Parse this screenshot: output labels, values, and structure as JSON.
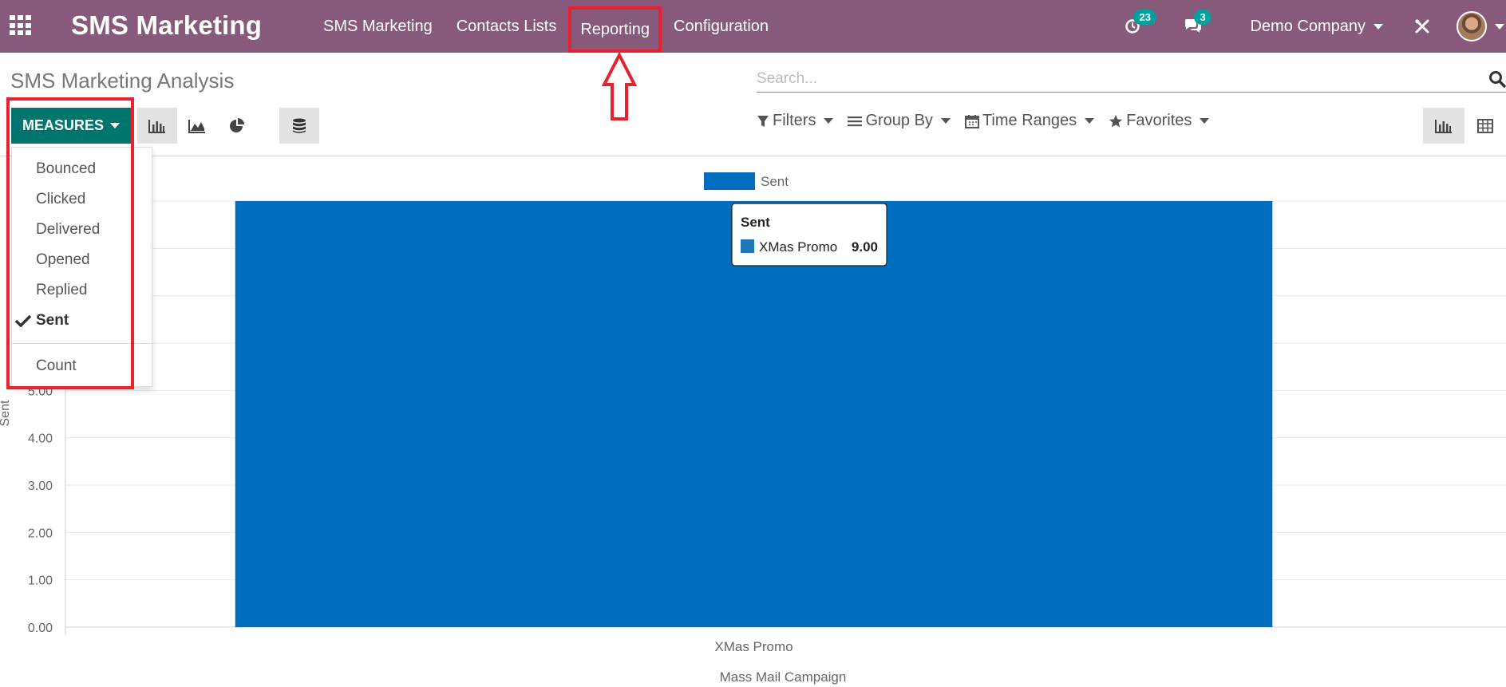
{
  "app": {
    "brand": "SMS Marketing",
    "menu": [
      "SMS Marketing",
      "Contacts Lists",
      "Reporting",
      "Configuration"
    ],
    "activity_count": "23",
    "message_count": "3",
    "company": "Demo Company"
  },
  "page": {
    "title": "SMS Marketing Analysis",
    "search_placeholder": "Search...",
    "measures_label": "MEASURES",
    "filters_label": "Filters",
    "groupby_label": "Group By",
    "timeranges_label": "Time Ranges",
    "favorites_label": "Favorites"
  },
  "measures": {
    "items": [
      "Bounced",
      "Clicked",
      "Delivered",
      "Opened",
      "Replied",
      "Sent"
    ],
    "selected": "Sent",
    "count_label": "Count"
  },
  "colors": {
    "navbar": "#875a7b",
    "primary": "#00756e",
    "bar": "#006dbf",
    "annotation": "#e8212e"
  },
  "chart_data": {
    "type": "bar",
    "categories": [
      "XMas Promo"
    ],
    "series": [
      {
        "name": "Sent",
        "values": [
          9.0
        ]
      }
    ],
    "xlabel": "Mass Mail Campaign",
    "ylabel": "Sent",
    "ylim": [
      0,
      9
    ],
    "yticks": [
      "0.00",
      "1.00",
      "2.00",
      "3.00",
      "4.00",
      "5.00"
    ],
    "legend": "top-center",
    "grid": true,
    "tooltip": {
      "title": "Sent",
      "label": "XMas Promo",
      "value": "9.00"
    }
  }
}
